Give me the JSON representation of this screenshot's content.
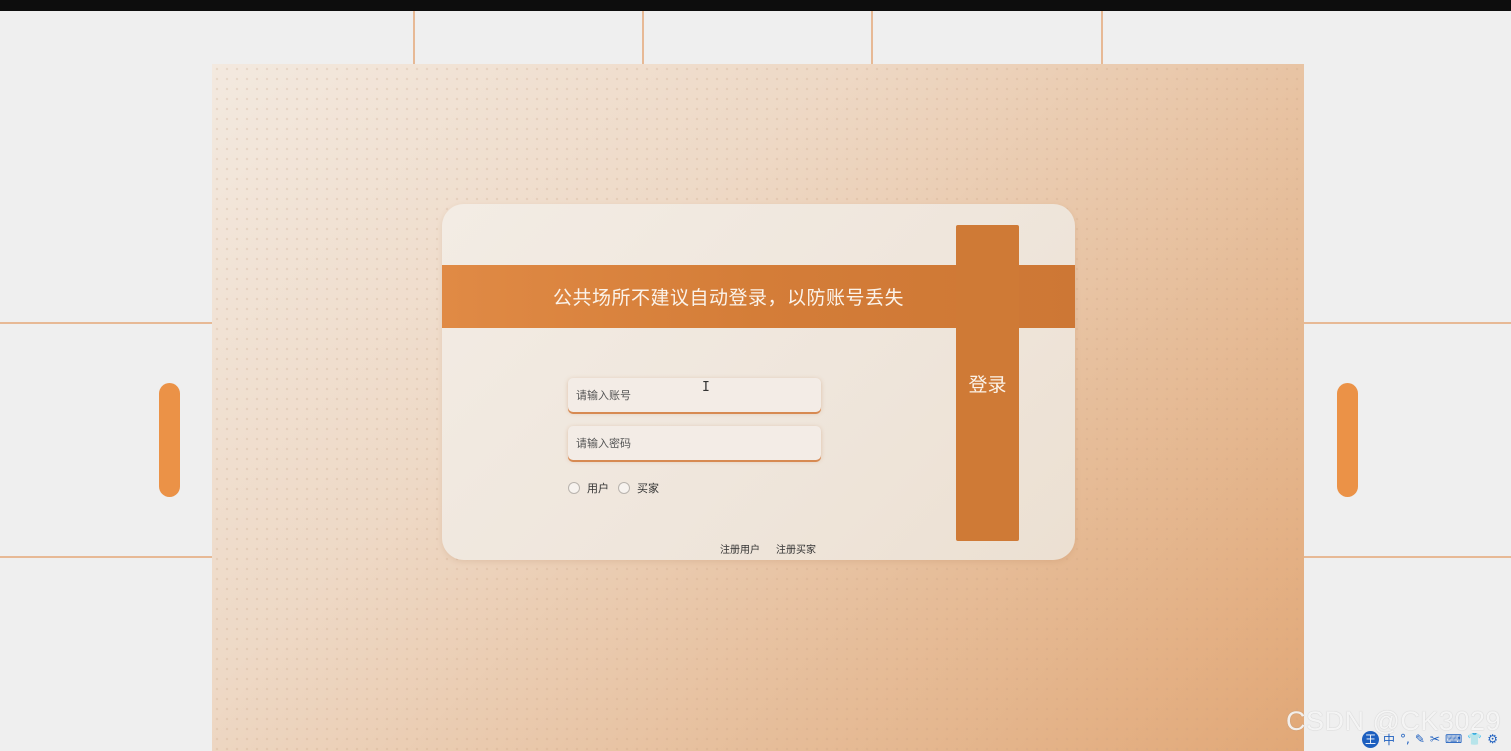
{
  "banner": {
    "text": "公共场所不建议自动登录，以防账号丢失"
  },
  "login": {
    "button_label": "登录",
    "account_placeholder": "请输入账号",
    "password_placeholder": "请输入密码",
    "role_options": [
      "用户",
      "买家"
    ],
    "links": [
      "注册用户",
      "注册买家"
    ]
  },
  "watermark": "CSDN @CK3029",
  "ime": {
    "logo": "王",
    "mode": "中",
    "icons": [
      "punctuation-icon",
      "pen-icon",
      "scissors-icon",
      "keyboard-icon",
      "skin-icon",
      "settings-icon"
    ]
  },
  "colors": {
    "accent": "#cf7a36",
    "banner": "#d47d38",
    "handle": "#eb9247"
  }
}
